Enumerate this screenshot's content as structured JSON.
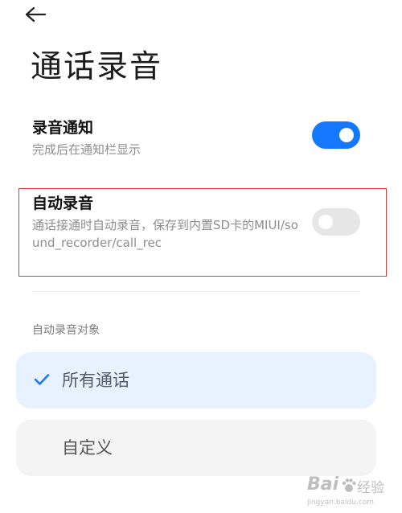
{
  "header": {
    "back_icon": "arrow-left-icon",
    "title": "通话录音"
  },
  "settings": {
    "record_notification": {
      "title": "录音通知",
      "description": "完成后在通知栏显示",
      "enabled": true,
      "toggle_color_on": "#1677ff"
    },
    "auto_record": {
      "title": "自动录音",
      "description": "通话接通时自动录音，保存到内置SD卡的MIUI/sound_recorder/call_rec",
      "enabled": false,
      "toggle_color_off": "#e6e6e6",
      "highlight_color": "#e53935"
    }
  },
  "auto_record_targets": {
    "section_label": "自动录音对象",
    "options": [
      {
        "label": "所有通话",
        "selected": true,
        "icon": "check-icon"
      },
      {
        "label": "自定义",
        "selected": false
      }
    ],
    "selected_bg": "#e8f1fe",
    "unselected_bg": "#f4f4f4",
    "selected_text_color": "#1677ff"
  },
  "watermark": {
    "brand": "Bai",
    "brand_2": "经验",
    "url": "jingyan.baidu.com"
  }
}
